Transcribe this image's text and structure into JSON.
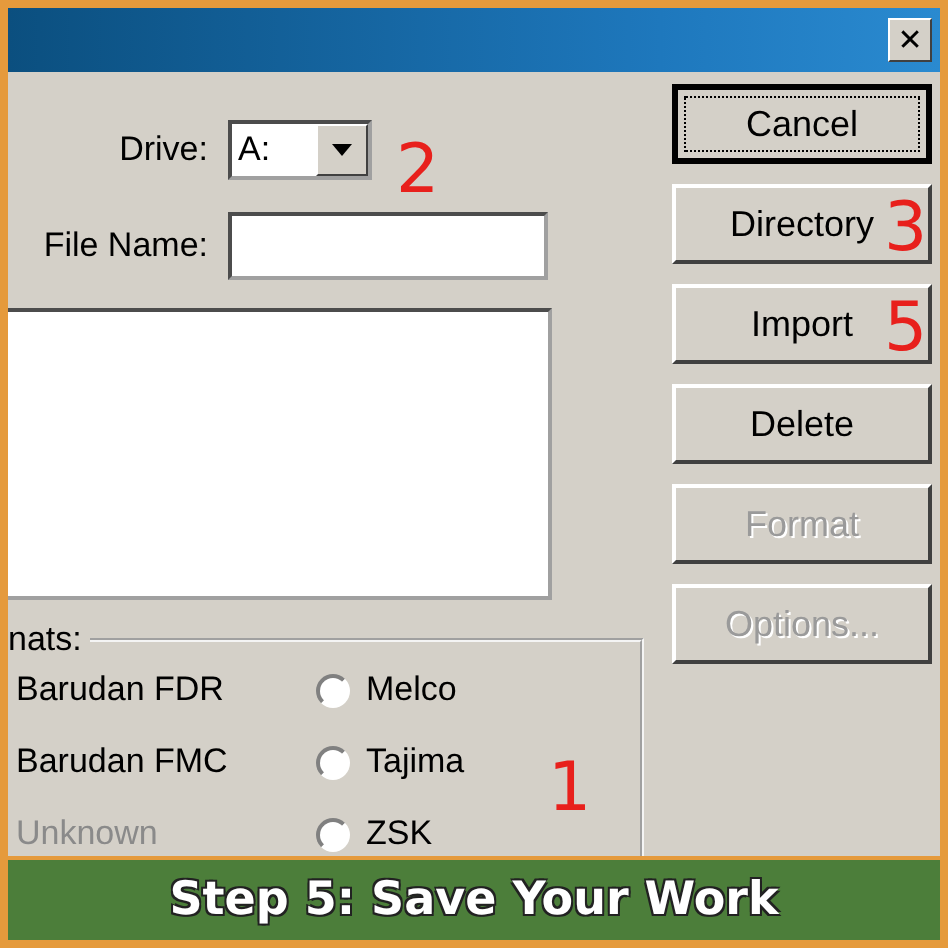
{
  "window": {
    "close": "✕"
  },
  "drive": {
    "label": "Drive:",
    "value": "A:"
  },
  "file_name": {
    "label": "File Name:"
  },
  "formats": {
    "label": "nats:",
    "options": [
      {
        "label": "Barudan FDR",
        "disabled": false
      },
      {
        "label": "Melco",
        "selected": false,
        "disabled": false
      },
      {
        "label": "Barudan FMC",
        "disabled": false
      },
      {
        "label": "Tajima",
        "selected": false,
        "disabled": false
      },
      {
        "label": "Unknown",
        "disabled": true
      },
      {
        "label": "ZSK",
        "selected": false,
        "disabled": false
      }
    ]
  },
  "buttons": [
    {
      "label": "Cancel",
      "default": true,
      "disabled": false
    },
    {
      "label": "Directory",
      "default": false,
      "disabled": false
    },
    {
      "label": "Import",
      "default": false,
      "disabled": false
    },
    {
      "label": "Delete",
      "default": false,
      "disabled": false
    },
    {
      "label": "Format",
      "default": false,
      "disabled": true
    },
    {
      "label": "Options...",
      "default": false,
      "disabled": true
    }
  ],
  "annotations": [
    {
      "text": "2"
    },
    {
      "text": "3"
    },
    {
      "text": "5"
    },
    {
      "text": "1"
    }
  ],
  "banner": {
    "text": "Step 5: Save Your Work"
  }
}
